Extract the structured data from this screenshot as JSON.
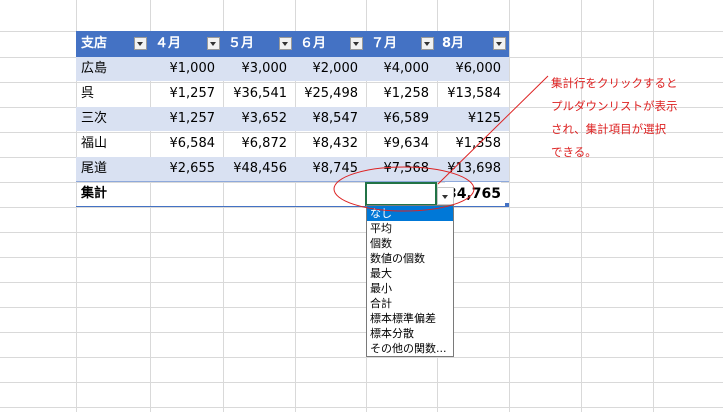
{
  "table": {
    "headers": [
      "支店",
      "４月",
      "５月",
      "６月",
      "７月",
      "8月"
    ],
    "rows": [
      [
        "広島",
        "¥1,000",
        "¥3,000",
        "¥2,000",
        "¥4,000",
        "¥6,000"
      ],
      [
        "呉",
        "¥1,257",
        "¥36,541",
        "¥25,498",
        "¥1,258",
        "¥13,584"
      ],
      [
        "三次",
        "¥1,257",
        "¥3,652",
        "¥8,547",
        "¥6,589",
        "¥125"
      ],
      [
        "福山",
        "¥6,584",
        "¥6,872",
        "¥8,432",
        "¥9,634",
        "¥1,358"
      ],
      [
        "尾道",
        "¥2,655",
        "¥48,456",
        "¥8,745",
        "¥7,568",
        "¥13,698"
      ]
    ],
    "total_label": "集計",
    "total_value": "34,765"
  },
  "dropdown": {
    "selected_index": 0,
    "options": [
      "なし",
      "平均",
      "個数",
      "数値の個数",
      "最大",
      "最小",
      "合計",
      "標本標準偏差",
      "標本分散",
      "その他の関数..."
    ]
  },
  "annotation": {
    "lines": [
      "集計行をクリックすると",
      "プルダウンリストが表示",
      "され、集計項目が選択",
      "できる。"
    ],
    "color": "#dd2222"
  },
  "colors": {
    "header": "#4472c4",
    "band": "#d9e1f2",
    "selection": "#0078d7",
    "active_cell_border": "#217346"
  }
}
